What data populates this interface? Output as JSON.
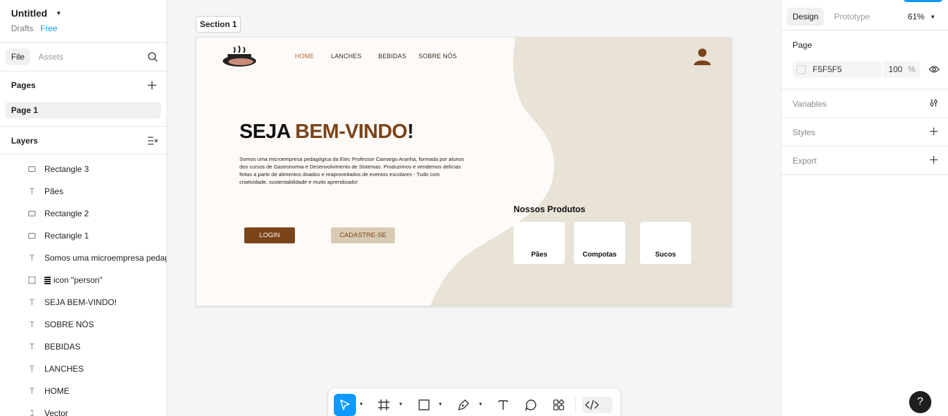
{
  "file": {
    "title": "Untitled",
    "location": "Drafts",
    "plan": "Free"
  },
  "left_tabs": {
    "file": "File",
    "assets": "Assets"
  },
  "pages": {
    "title": "Pages",
    "items": [
      "Page 1"
    ]
  },
  "layers": {
    "title": "Layers",
    "items": [
      {
        "name": "Rectangle 3",
        "icon": "rectangle-icon"
      },
      {
        "name": "Pães",
        "icon": "text-icon"
      },
      {
        "name": "Rectangle 2",
        "icon": "rectangle-icon"
      },
      {
        "name": "Rectangle 1",
        "icon": "rectangle-icon"
      },
      {
        "name": "Somos uma microempresa pedagógica",
        "icon": "text-icon"
      },
      {
        "name": "icon \"person\"",
        "icon": "frame-icon"
      },
      {
        "name": "SEJA BEM-VINDO!",
        "icon": "text-icon"
      },
      {
        "name": "SOBRE NÓS",
        "icon": "text-icon"
      },
      {
        "name": "BEBIDAS",
        "icon": "text-icon"
      },
      {
        "name": "LANCHES",
        "icon": "text-icon"
      },
      {
        "name": "HOME",
        "icon": "text-icon"
      },
      {
        "name": "Vector",
        "icon": "vector-icon"
      }
    ]
  },
  "canvas": {
    "section_label": "Section 1",
    "site": {
      "nav": [
        "HOME",
        "LANCHES",
        "BEBIDAS",
        "SOBRE NÓS"
      ],
      "hero_part1": "SEJA ",
      "hero_part2": "BEM-VINDO",
      "hero_part3": "!",
      "description": "Somos uma microempresa pedagógica da Etec Professor Camargo Aranha, formada por alunos dos cursos de Gastronomia e Desenvolvimento de Sistemas. Produzimos e vendemos delícias feitas a partir de alimentos doados e reaproveitados de eventos escolares - Tudo com criatividade, sustentabilidade e muito aprendizado!",
      "login": "LOGIN",
      "signup": "CADASTRE-SE",
      "products_title": "Nossos Produtos",
      "products": [
        "Pães",
        "Compotas",
        "Sucos"
      ],
      "colors": {
        "brown": "#7a4318",
        "beige": "#e8e2d7",
        "light_beige": "#d9cbb3",
        "accent": "#b26b2a"
      }
    }
  },
  "toolbar": {
    "tools": [
      "move-tool",
      "frame-tool",
      "rectangle-tool",
      "pen-tool",
      "text-tool",
      "comment-tool",
      "actions-tool",
      "dev-mode-toggle"
    ]
  },
  "right": {
    "tabs": {
      "design": "Design",
      "prototype": "Prototype"
    },
    "zoom": "61%",
    "page": {
      "title": "Page",
      "color": "F5F5F5",
      "opacity": "100",
      "pct": "%"
    },
    "variables": "Variables",
    "styles": "Styles",
    "export": "Export",
    "help": "?"
  },
  "theme": {
    "accent": "#0d99ff"
  }
}
